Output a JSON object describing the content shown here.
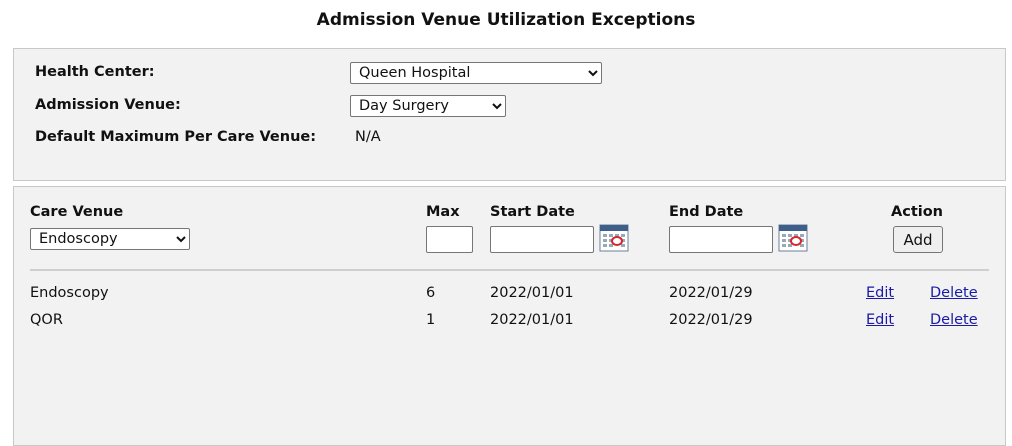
{
  "page": {
    "title": "Admission Venue Utilization Exceptions"
  },
  "filters": {
    "health_center_label": "Health Center:",
    "health_center_value": "Queen Hospital",
    "admission_venue_label": "Admission Venue:",
    "admission_venue_value": "Day Surgery",
    "default_max_label": "Default Maximum Per Care Venue:",
    "default_max_value": "N/A"
  },
  "form": {
    "care_venue_label": "Care Venue",
    "care_venue_value": "Endoscopy",
    "max_label": "Max",
    "max_value": "",
    "start_date_label": "Start Date",
    "start_date_value": "",
    "end_date_label": "End Date",
    "end_date_value": "",
    "action_label": "Action",
    "add_button_label": "Add",
    "calendar_icon": "calendar-icon"
  },
  "rows": [
    {
      "care_venue": "Endoscopy",
      "max": "6",
      "start_date": "2022/01/01",
      "end_date": "2022/01/29",
      "edit_label": "Edit",
      "delete_label": "Delete"
    },
    {
      "care_venue": "QOR",
      "max": "1",
      "start_date": "2022/01/01",
      "end_date": "2022/01/29",
      "edit_label": "Edit",
      "delete_label": "Delete"
    }
  ],
  "colors": {
    "panel_bg": "#f2f2f2",
    "link": "#1a1aa6"
  }
}
